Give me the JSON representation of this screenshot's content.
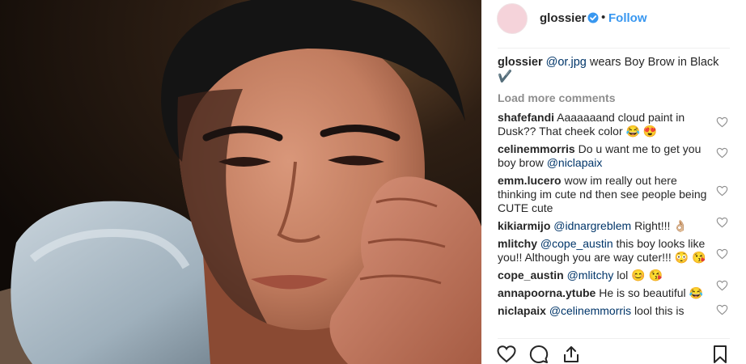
{
  "post": {
    "username": "glossier",
    "follow_label": "Follow",
    "dot": "•"
  },
  "caption": {
    "user": "glossier",
    "mention": "@or.jpg",
    "text": " wears Boy Brow in Black ✔️"
  },
  "load_more": "Load more comments",
  "comments": [
    {
      "user": "shafefandi",
      "mention": "",
      "text": "Aaaaaaand cloud paint in Dusk?? That cheek color 😂 😍"
    },
    {
      "user": "celinemmorris",
      "mention": "",
      "text": "Do u want me to get you boy brow ",
      "mention_after": "@niclapaix"
    },
    {
      "user": "emm.lucero",
      "mention": "",
      "text": "wow im really out here thinking im cute nd then see people being CUTE cute"
    },
    {
      "user": "kikiarmijo",
      "mention": "@idnargreblem",
      "text": " Right!!! 👌🏼"
    },
    {
      "user": "mlitchy",
      "mention": "@cope_austin",
      "text": " this boy looks like you!! Although you are way cuter!!! 😳 😘"
    },
    {
      "user": "cope_austin",
      "mention": "@mlitchy",
      "text": " lol 😊 😘"
    },
    {
      "user": "annapoorna.ytube",
      "mention": "",
      "text": "He is so beautiful 😂"
    },
    {
      "user": "niclapaix",
      "mention": "@celinemmorris",
      "text": " lool this is"
    }
  ],
  "icons": {
    "verified": "verified-badge-icon",
    "like": "heart-icon",
    "comment": "comment-icon",
    "share": "share-icon",
    "save": "bookmark-icon"
  },
  "colors": {
    "accent": "#3897f0",
    "mention": "#003569",
    "muted": "#8e8e8e"
  }
}
